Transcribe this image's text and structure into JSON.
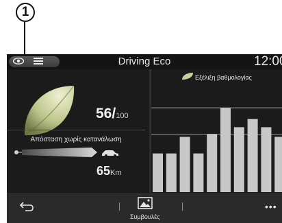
{
  "callout": {
    "number": "1"
  },
  "header": {
    "title": "Driving Eco",
    "clock": "12:00"
  },
  "score": {
    "value": "56/",
    "max": "100"
  },
  "distance": {
    "label": "Απόσταση χωρίς κατανάλωση",
    "value": "65",
    "unit": "Km"
  },
  "history": {
    "legend": "Εξέλιξη βαθμολογίας"
  },
  "bottom": {
    "tips_label": "Συμβουλές",
    "more_label": "•••"
  },
  "chart_data": {
    "type": "bar",
    "title": "Εξέλιξη βαθμολογίας",
    "values": [
      28,
      28,
      40,
      28,
      42,
      61,
      47,
      53,
      47,
      40
    ],
    "ylim": [
      0,
      75
    ],
    "reference_lines": [
      42,
      61
    ],
    "grid": false,
    "bar_color": "#c8c8c8"
  },
  "colors": {
    "screen_bg": "#1b1b1b",
    "bar": "#c8c8c8",
    "leaf": "#d2d8a8"
  }
}
